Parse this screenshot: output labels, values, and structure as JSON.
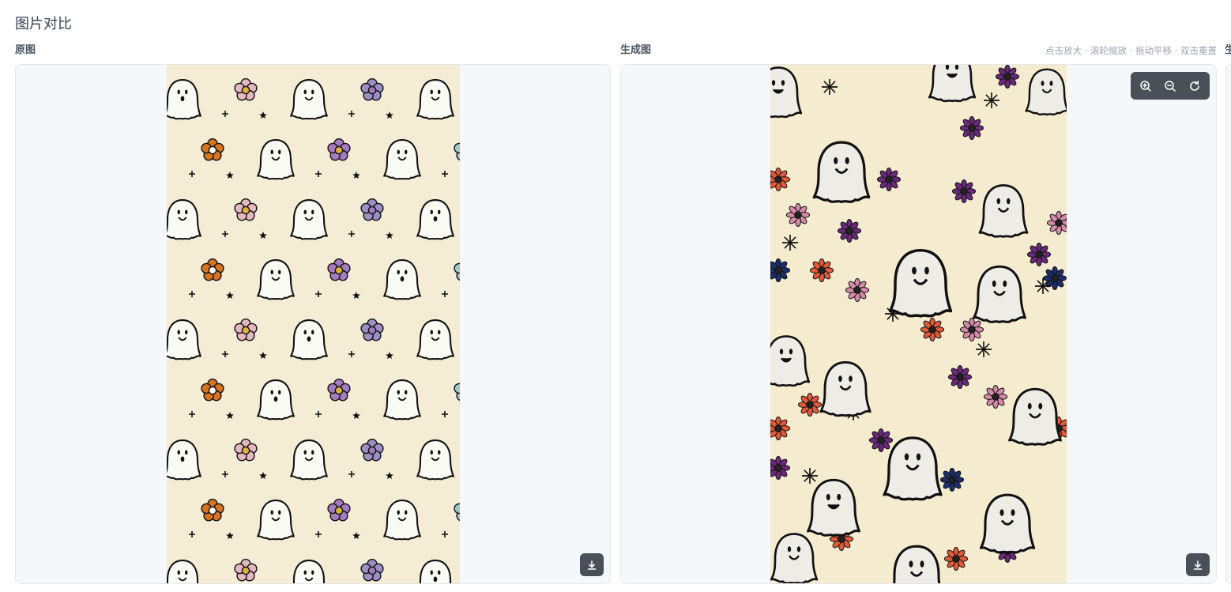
{
  "page": {
    "title": "图片对比"
  },
  "panels": {
    "original": {
      "label": "原图",
      "download_icon": "download-icon"
    },
    "generated": {
      "label": "生成图",
      "hint": "点击放大 · 滚轮缩放 · 拖动平移 · 双击重置",
      "toolbar": {
        "zoom_in_icon": "zoom-in-icon",
        "zoom_out_icon": "zoom-out-icon",
        "reset_icon": "reset-icon"
      },
      "download_icon": "download-icon"
    },
    "third": {
      "label_partial": "生"
    }
  },
  "colors": {
    "panel_bg": "#f5f7fb",
    "pattern_bg_original": "#f4ecd5",
    "pattern_bg_generated": "#f5ecd0",
    "control_bg": "#4b5058"
  }
}
